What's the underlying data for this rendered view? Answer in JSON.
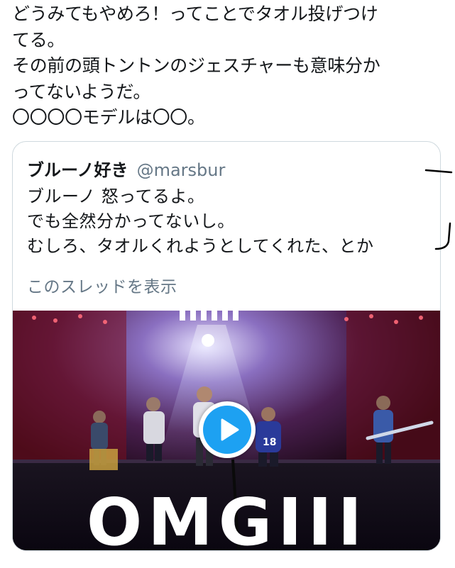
{
  "tweet": {
    "lines": [
      "どうみてもやめろ！ってことでタオル投げつけ",
      "てる。",
      "その前の頭トントンのジェスチャーも意味分か",
      "ってないようだ。",
      "〇〇〇〇モデルは〇〇。"
    ]
  },
  "quote": {
    "display_name": "ブルーノ好き",
    "handle": "@marsbur",
    "lines": [
      "ブルーノ 怒ってるよ。",
      "でも全然分かってないし。",
      "むしろ、タオルくれようとしてくれた、とか"
    ],
    "thread_link": "このスレッドを表示"
  },
  "video": {
    "overlay_text": "OMGIII",
    "play_icon": "play-icon",
    "jersey_number": "18"
  },
  "colors": {
    "text": "#14171a",
    "secondary": "#657786",
    "border": "#cfd9de",
    "play_blue": "#1da1f2"
  }
}
